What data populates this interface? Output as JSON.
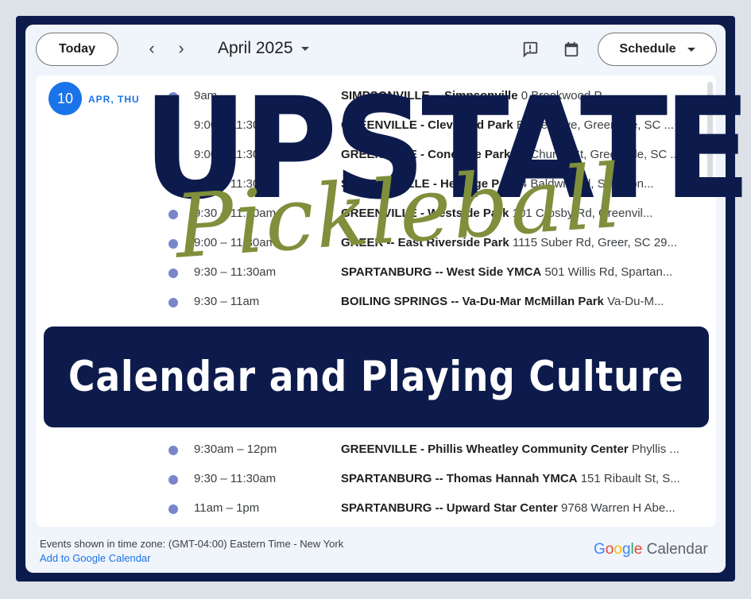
{
  "toolbar": {
    "today_label": "Today",
    "prev_icon": "chevron-left",
    "next_icon": "chevron-right",
    "month_label": "April 2025",
    "feedback_icon": "report-icon",
    "calendar_icon": "calendar-icon",
    "view_label": "Schedule"
  },
  "schedule": {
    "date_number": "10",
    "date_label": "APR, THU",
    "events": [
      {
        "time": "9am",
        "title": "SIMPSONVILLE -- Simpsonville",
        "location": "0 Brookwood P..."
      },
      {
        "time": "9:00 – 11:30am",
        "title": "GREENVILLE - Cleveland Park",
        "location": "Everett Ave, Greenville, SC ..."
      },
      {
        "time": "9:00 – 11:30am",
        "title": "GREENVILLE - Conestee Park",
        "location": "21 Church St, Greenville, SC ..."
      },
      {
        "time": "9:00 – 11:30am",
        "title": "SIMPSONVILLE - Heritage Park",
        "location": "4 Baldwin Rd, Simpson..."
      },
      {
        "time": "9:30 – 11:30am",
        "title": "GREENVILLE - Westside Park",
        "location": "101 Crosby Rd, Greenvil..."
      },
      {
        "time": "9:00 – 11:30am",
        "title": "GREER -- East Riverside Park",
        "location": "1115 Suber Rd, Greer, SC 29..."
      },
      {
        "time": "9:30 – 11:30am",
        "title": "SPARTANBURG -- West Side YMCA",
        "location": "501 Willis Rd, Spartan..."
      },
      {
        "time": "9:30 – 11am",
        "title": "BOILING SPRINGS -- Va-Du-Mar McMillan Park",
        "location": "Va-Du-M..."
      },
      {
        "time": "9:30am – 12pm",
        "title": "GREENVILLE - Phillis Wheatley Community Center",
        "location": "Phyllis ..."
      },
      {
        "time": "9:30 – 11:30am",
        "title": "SPARTANBURG -- Thomas Hannah YMCA",
        "location": "151 Ribault St, S..."
      },
      {
        "time": "11am – 1pm",
        "title": "SPARTANBURG -- Upward Star Center",
        "location": "9768 Warren H Abe..."
      }
    ]
  },
  "footer": {
    "timezone": "Events shown in time zone: (GMT-04:00) Eastern Time - New York",
    "add_link": "Add to Google Calendar",
    "brand_g1": "G",
    "brand_o1": "o",
    "brand_o2": "o",
    "brand_g2": "g",
    "brand_l": "l",
    "brand_e": "e",
    "brand_word": "Calendar"
  },
  "overlay": {
    "title": "UPSTATE",
    "script": "Pickleball",
    "banner": "Calendar and Playing Culture"
  },
  "colors": {
    "navy": "#0d1b4c",
    "olive": "#7f8f3b",
    "event_dot": "#7986cb",
    "google_blue": "#1a73e8"
  }
}
